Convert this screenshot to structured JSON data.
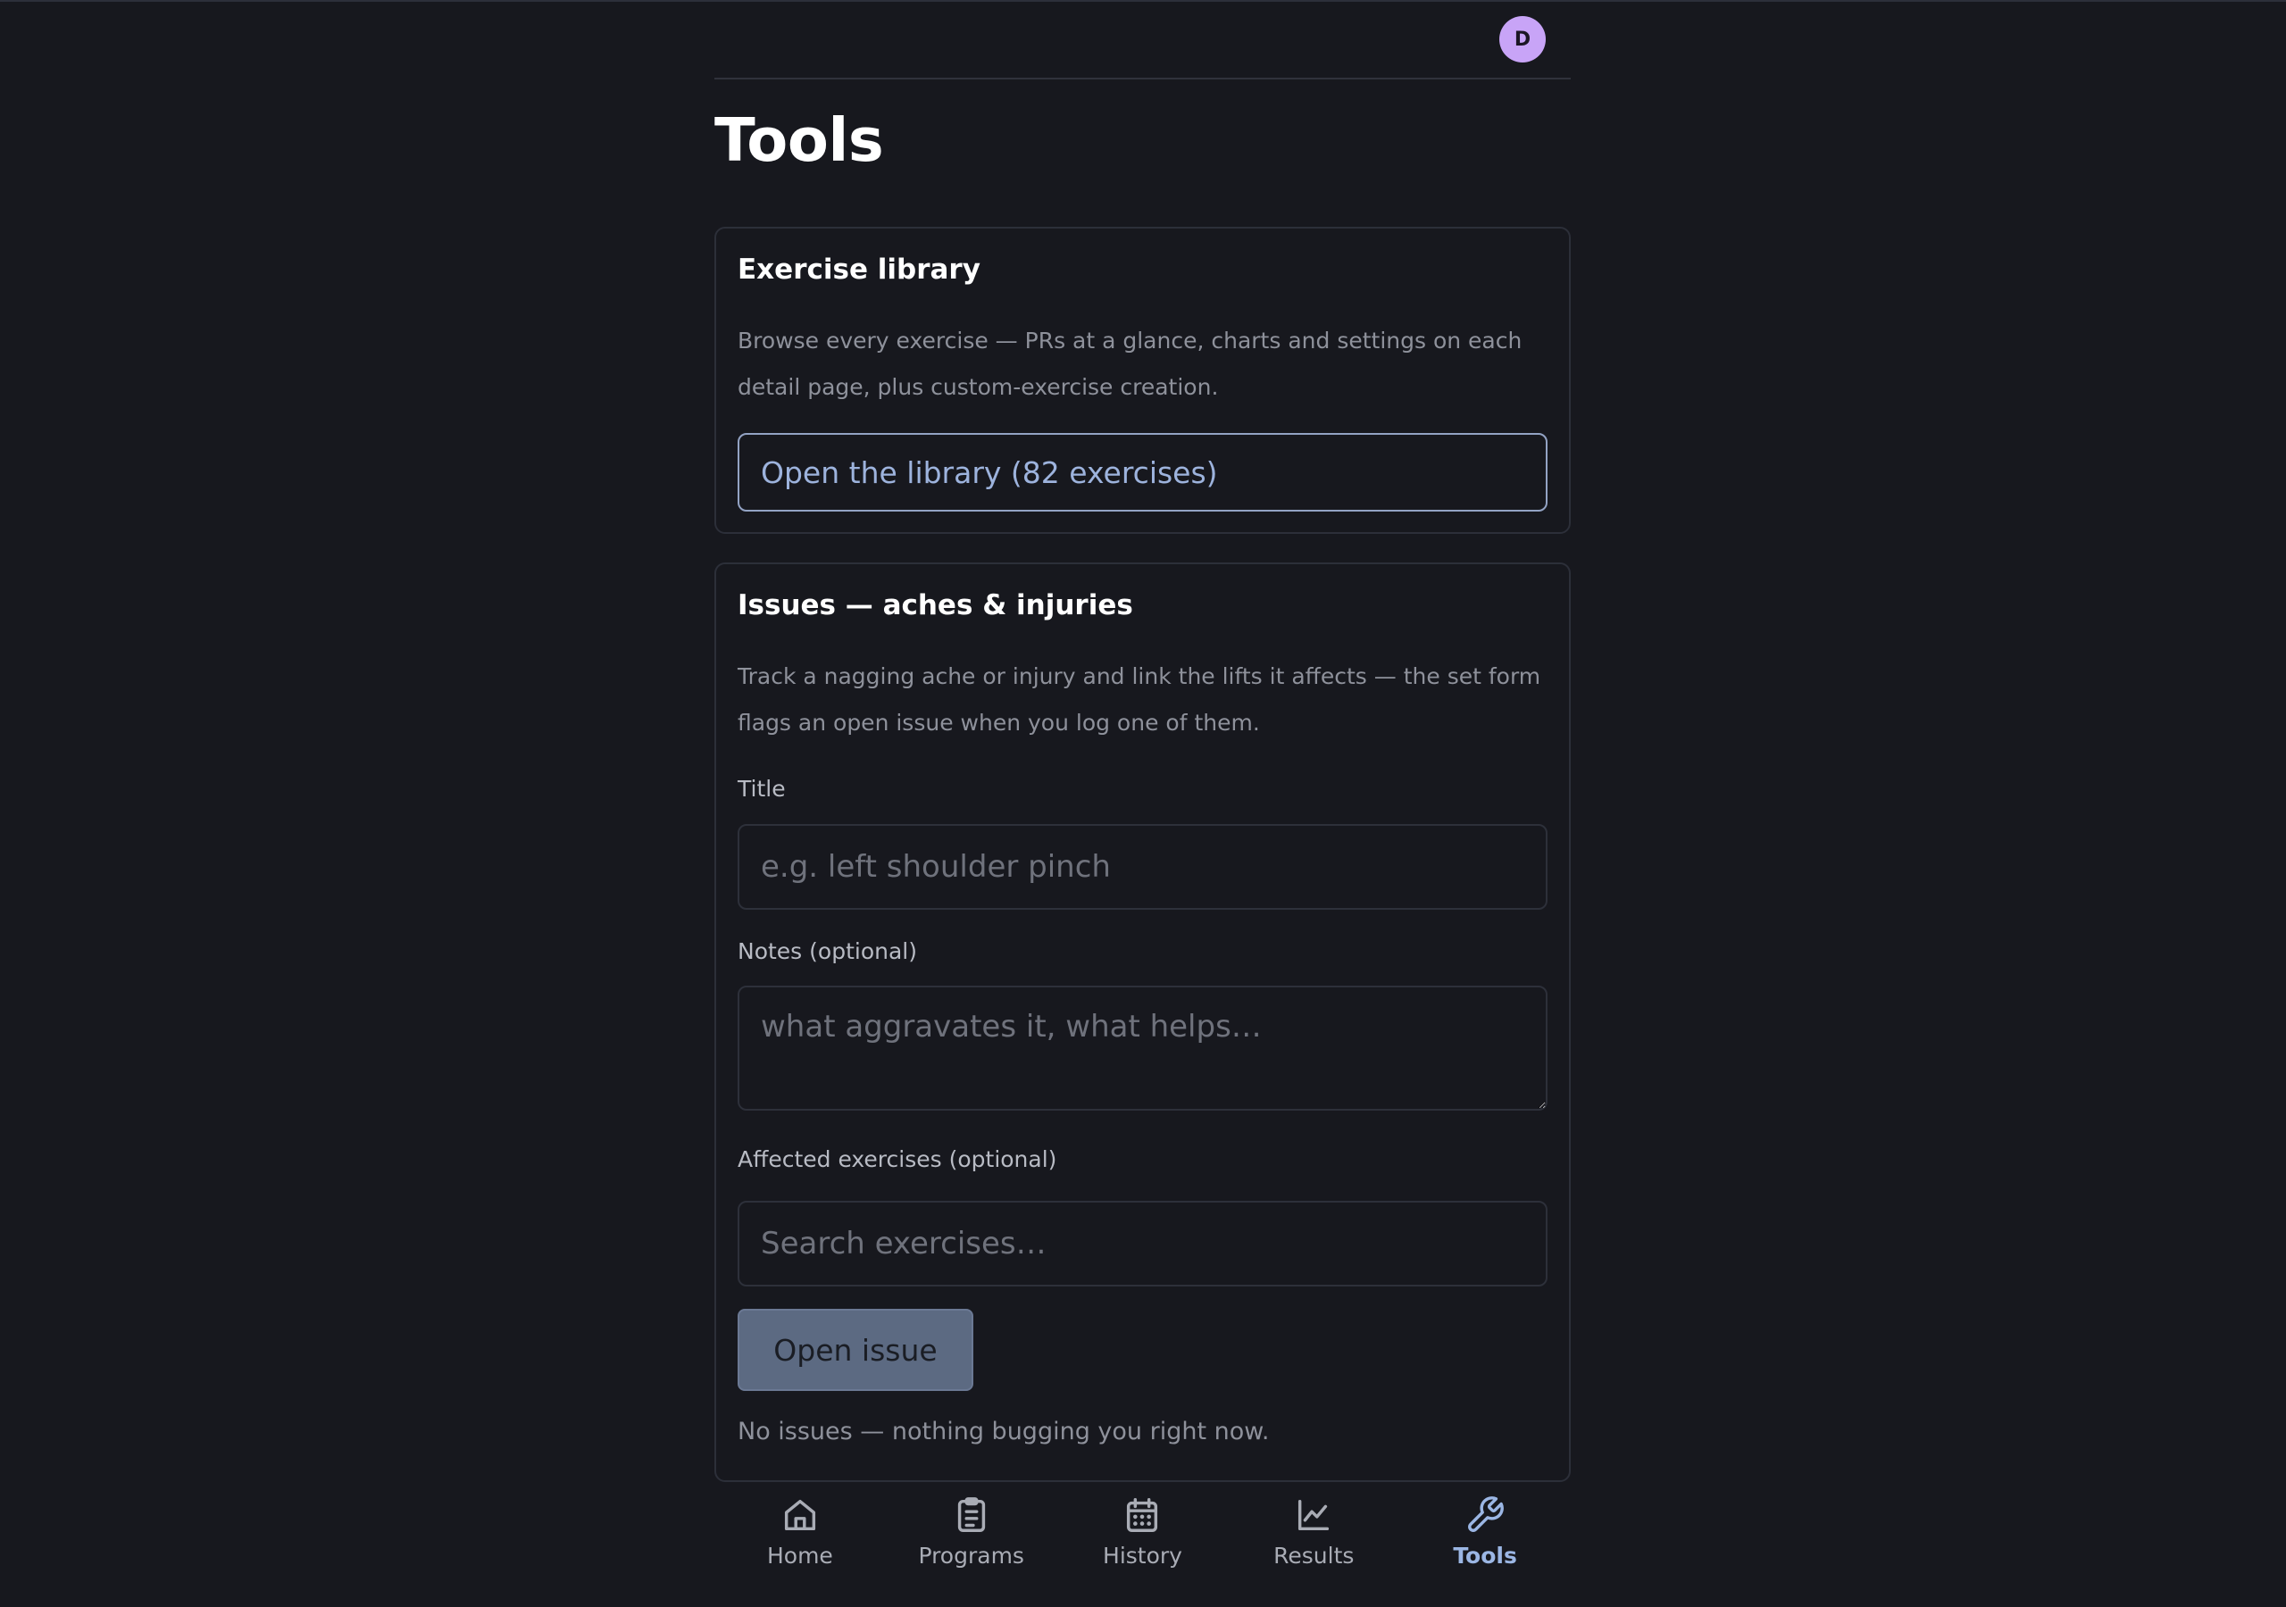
{
  "user": {
    "avatar_initial": "D"
  },
  "page": {
    "title": "Tools"
  },
  "library_card": {
    "title": "Exercise library",
    "description": "Browse every exercise — PRs at a glance, charts and settings on each detail page, plus custom-exercise creation.",
    "button_label": "Open the library (82 exercises)"
  },
  "issues_card": {
    "title": "Issues — aches & injuries",
    "description": "Track a nagging ache or injury and link the lifts it affects — the set form flags an open issue when you log one of them.",
    "title_field": {
      "label": "Title",
      "placeholder": "e.g. left shoulder pinch"
    },
    "notes_field": {
      "label": "Notes (optional)",
      "placeholder": "what aggravates it, what helps…"
    },
    "affected_field": {
      "label": "Affected exercises (optional)",
      "placeholder": "Search exercises…"
    },
    "submit_label": "Open issue",
    "empty_state": "No issues — nothing bugging you right now."
  },
  "nav": {
    "items": [
      {
        "label": "Home",
        "icon": "home-icon"
      },
      {
        "label": "Programs",
        "icon": "clipboard-icon"
      },
      {
        "label": "History",
        "icon": "calendar-icon"
      },
      {
        "label": "Results",
        "icon": "chart-icon"
      },
      {
        "label": "Tools",
        "icon": "wrench-icon"
      }
    ],
    "active": "Tools"
  },
  "colors": {
    "background": "#17181e",
    "accent": "#9bb6e4",
    "avatar": "#c8a4f7",
    "button_disabled": "#5c6a82"
  }
}
